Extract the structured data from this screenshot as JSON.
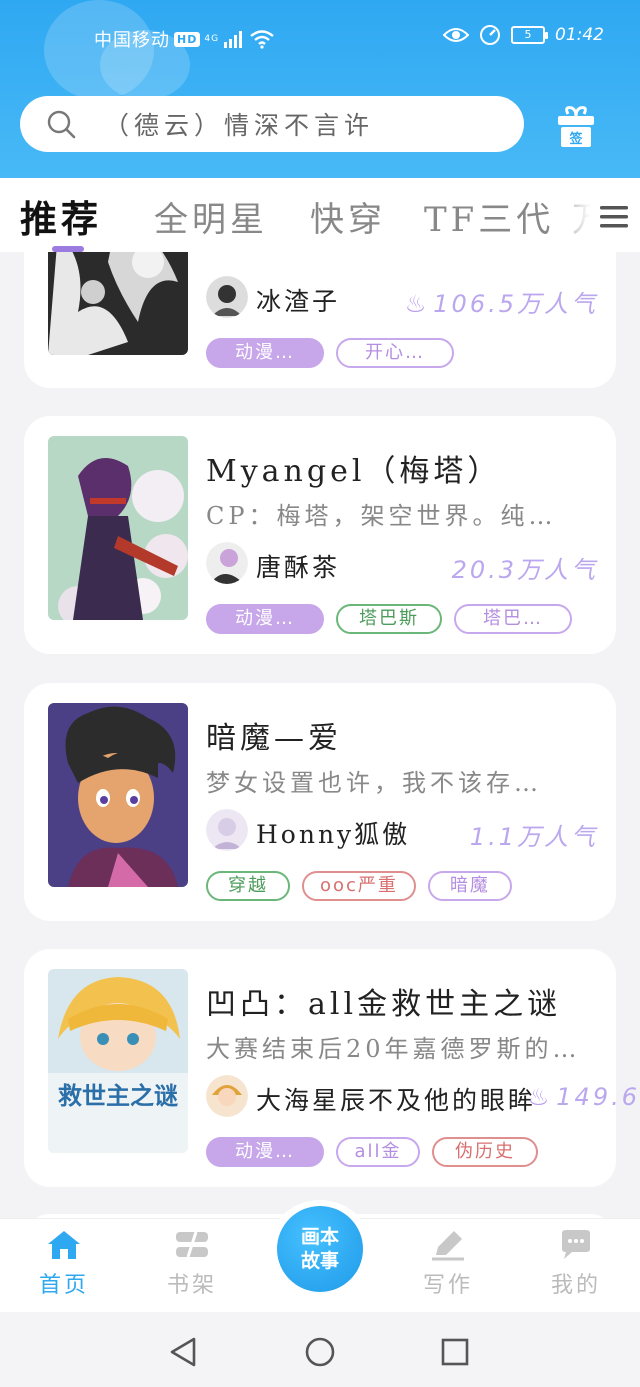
{
  "status_bar": {
    "carrier": "中国移动",
    "hd_badge": "HD",
    "network": "4G",
    "battery": "5",
    "time": "01:42"
  },
  "search": {
    "placeholder": "（德云）情深不言许",
    "gift_label": "签"
  },
  "tabs": [
    {
      "label": "推荐",
      "active": true
    },
    {
      "label": "全明星",
      "active": false
    },
    {
      "label": "快穿",
      "active": false
    },
    {
      "label": "TF三代",
      "active": false
    },
    {
      "label": "万",
      "active": false
    }
  ],
  "cards": [
    {
      "author": "冰渣子",
      "popularity": "106.5万人气",
      "tags": [
        {
          "label": "动漫…",
          "style": "filled"
        },
        {
          "label": "开心…",
          "style": "purple"
        }
      ]
    },
    {
      "title": "Myangel（梅塔）",
      "description": "CP：梅塔，架空世界。纯…",
      "author": "唐酥茶",
      "popularity": "20.3万人气",
      "tags": [
        {
          "label": "动漫…",
          "style": "filled"
        },
        {
          "label": "塔巴斯",
          "style": "green"
        },
        {
          "label": "塔巴…",
          "style": "purple"
        }
      ]
    },
    {
      "title": "暗魔—爱",
      "description": "梦女设置也许，我不该存…",
      "author": "Honny狐傲",
      "popularity": "1.1万人气",
      "tags": [
        {
          "label": "穿越",
          "style": "green"
        },
        {
          "label": "ooc严重",
          "style": "red"
        },
        {
          "label": "暗魔",
          "style": "purple"
        }
      ]
    },
    {
      "title": "凹凸：all金救世主之谜",
      "description": "大赛结束后20年嘉德罗斯的…",
      "author": "大海星辰不及他的眼眸",
      "popularity": "149.6",
      "cover_text": "救世主之谜",
      "tags": [
        {
          "label": "动漫…",
          "style": "filled"
        },
        {
          "label": "all金",
          "style": "purple"
        },
        {
          "label": "伪历史",
          "style": "red"
        }
      ]
    }
  ],
  "bottom_nav": {
    "home": "首页",
    "shelf": "书架",
    "center_line1": "画本",
    "center_line2": "故事",
    "write": "写作",
    "mine": "我的"
  },
  "colors": {
    "header_blue": "#2fa8f2",
    "accent_purple": "#c7a6ea",
    "popularity": "#bba7ee"
  }
}
